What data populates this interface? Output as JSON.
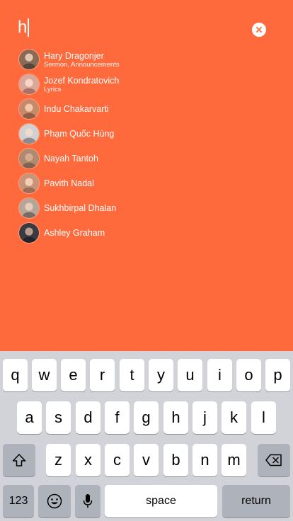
{
  "search": {
    "query": "h"
  },
  "results": [
    {
      "name": "Hary Dragonjer",
      "subtitle": "Sermon, Announcements",
      "avatar_color": "#8a6a55"
    },
    {
      "name": "Jozef Kondratovich",
      "subtitle": "Lyrics",
      "avatar_color": "#d8a89a"
    },
    {
      "name": "Indu Chakarvarti",
      "subtitle": "",
      "avatar_color": "#c68a6a"
    },
    {
      "name": "Phạm Quốc Hùng",
      "subtitle": "",
      "avatar_color": "#d0d0d0"
    },
    {
      "name": "Nayah Tantoh",
      "subtitle": "",
      "avatar_color": "#b08a70"
    },
    {
      "name": "Pavith Nadal",
      "subtitle": "",
      "avatar_color": "#c89478"
    },
    {
      "name": "Sukhbirpal Dhalan",
      "subtitle": "",
      "avatar_color": "#b6a69a"
    },
    {
      "name": "Ashley Graham",
      "subtitle": "",
      "avatar_color": "#3a3a42"
    }
  ],
  "keyboard": {
    "row1": [
      "q",
      "w",
      "e",
      "r",
      "t",
      "y",
      "u",
      "i",
      "o",
      "p"
    ],
    "row2": [
      "a",
      "s",
      "d",
      "f",
      "g",
      "h",
      "j",
      "k",
      "l"
    ],
    "row3": [
      "z",
      "x",
      "c",
      "v",
      "b",
      "n",
      "m"
    ],
    "numbers_label": "123",
    "space_label": "space",
    "return_label": "return"
  },
  "colors": {
    "accent": "#ff6a3d",
    "keyboard_bg": "#d2d3d8",
    "key_dark": "#aeb2bb"
  }
}
